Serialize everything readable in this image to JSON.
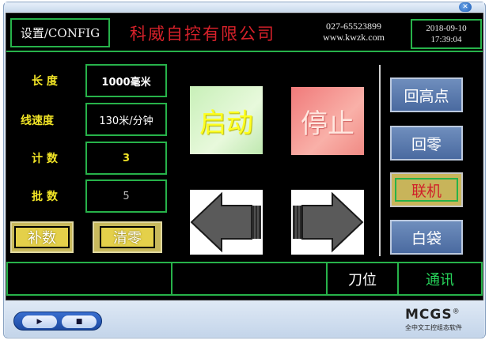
{
  "header": {
    "config_label": "设置/CONFIG",
    "brand_name": "科威自控有限公司",
    "phone": "027-65523899",
    "website": "www.kwzk.com",
    "date": "2018-09-10",
    "time": "17:39:04"
  },
  "params": {
    "length_label": "长  度",
    "length_value": "1000毫米",
    "speed_label": "线速度",
    "speed_value": "130米/分钟",
    "count_label": "计  数",
    "count_value": "3",
    "batch_label": "批  数",
    "batch_value": "5"
  },
  "buttons": {
    "supplement": "补数",
    "clear": "清零",
    "start": "启动",
    "stop": "停止",
    "return_high": "回高点",
    "return_zero": "回零",
    "online": "联机",
    "white_bag": "白袋"
  },
  "status_bar": {
    "cell1": "",
    "cell2": "",
    "knife_position": "刀位",
    "communication": "通讯"
  },
  "footer": {
    "logo": "MCGS",
    "registered": "®",
    "tagline": "全中文工控组态软件"
  },
  "colors": {
    "accent_green": "#27b24a",
    "label_yellow": "#f2e526",
    "brand_red": "#d6212a"
  },
  "icons": {
    "left_arrow": "left-arrow-icon",
    "right_arrow": "right-arrow-icon",
    "play": "play-icon",
    "stop": "stop-icon",
    "close": "close-icon"
  }
}
